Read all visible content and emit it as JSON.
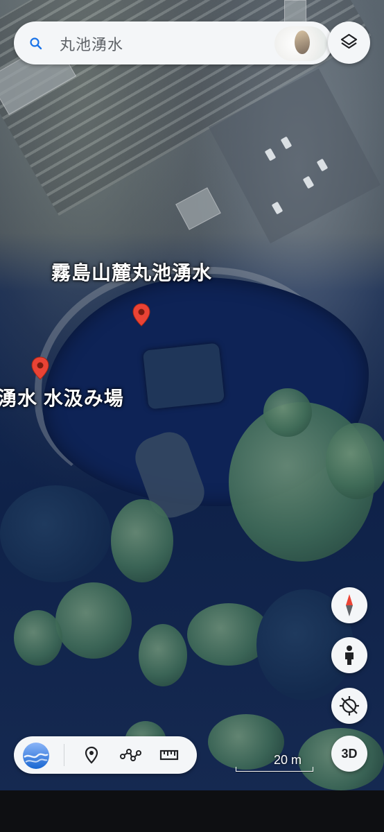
{
  "search": {
    "query": "丸池湧水",
    "icon": "search-icon"
  },
  "map": {
    "type": "satellite",
    "labels": {
      "main_place": "霧島山麓丸池湧水",
      "secondary_place": "湧水 水汲み場"
    },
    "pin_color": "#ea4335"
  },
  "controls": {
    "three_d_label": "3D",
    "compass_icon": "compass-icon",
    "street_view_icon": "pegman-icon",
    "location_icon": "location-off-icon",
    "layers_icon": "layers-icon"
  },
  "scale": {
    "label": "20 m"
  },
  "toolbar": {
    "items": [
      "earth-logo-icon",
      "place-marker-icon",
      "draw-path-icon",
      "measure-icon"
    ]
  }
}
